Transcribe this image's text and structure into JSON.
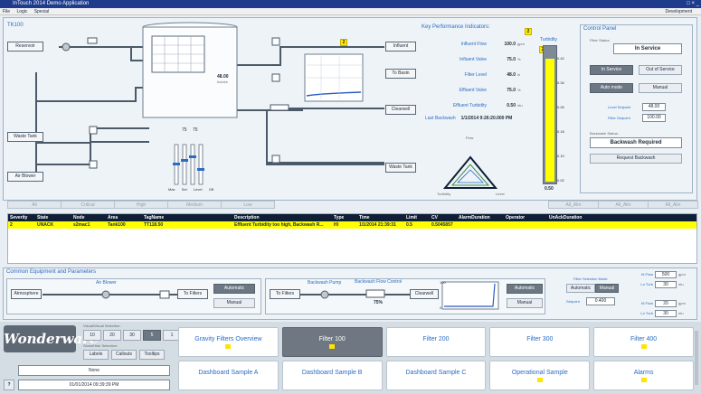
{
  "window": {
    "title": "InTouch 2014 Demo Application",
    "controls": "□ × _"
  },
  "menu": {
    "file": "File",
    "logic": "Logic",
    "special": "Special",
    "development": "Development"
  },
  "process": {
    "area_label": "TK100",
    "reservoir": "Reservoir",
    "waste_tank": "Waste Tank",
    "air_blower": "Air Blower",
    "influent": "Influent",
    "to_basin": "To Basin",
    "clearwell": "Clearwell",
    "waste_tank_2": "Waste Tank",
    "level_value": "48.00",
    "level_unit": "Inches",
    "valve_pct_1": "75",
    "valve_pct_2": "75",
    "level_labels": [
      "Max",
      "Set",
      "Level",
      "Off"
    ],
    "badge_1": "2"
  },
  "kpi": {
    "title": "Key Performance Indicators:",
    "rows": [
      {
        "label": "Influent Flow",
        "value": "100.0",
        "unit": "gpm"
      },
      {
        "label": "Influent Valve",
        "value": "75.0",
        "unit": "%"
      },
      {
        "label": "Filter Level",
        "value": "48.0",
        "unit": "in"
      },
      {
        "label": "Effluent Valve",
        "value": "75.0",
        "unit": "%"
      },
      {
        "label": "Effluent Turbidity",
        "value": "0.50",
        "unit": "ntu"
      }
    ],
    "last_backwash_label": "Last Backwash",
    "last_backwash_value": "1/1/2014 9:26:20.000 PM",
    "badge": "2"
  },
  "turbidity": {
    "title": "Turbidity",
    "badge": "2",
    "fill_fraction": 0.92,
    "ticks": [
      "0.42",
      "0.34",
      "0.26",
      "0.18",
      "0.10",
      "0.02"
    ],
    "bottom_value": "0.50",
    "gauge": {
      "flow": "Flow",
      "turbidity": "Turbidity",
      "level": "Level"
    }
  },
  "control_panel": {
    "title": "Control Panel",
    "filter_status_label": "Filter Status:",
    "filter_status": "In Service",
    "in_service_btn": "In Service",
    "out_of_service_btn": "Out of Service",
    "auto_mode_btn": "Auto mode",
    "manual_btn": "Manual",
    "level_setpoint_label": "Level Setpoint",
    "level_setpoint": "48.00",
    "flow_setpoint_label": "Filter Setpoint",
    "flow_setpoint": "100.00",
    "backwash_status_label": "Backwash Status:",
    "backwash_status": "Backwash Required",
    "request_backwash_btn": "Request Backwash"
  },
  "alarms": {
    "tabs": [
      "All",
      "Critical",
      "High",
      "Medium",
      "Low",
      "All_Alm",
      "All_Alm",
      "All_Alm"
    ],
    "columns": [
      "Severity",
      "State",
      "Node",
      "Area",
      "TagName",
      "Description",
      "Type",
      "Time",
      "Limit",
      "CV",
      "AlarmDuration",
      "Operator",
      "UnAckDuration"
    ],
    "rows": [
      [
        "2",
        "UNACK",
        "s2mac1",
        "Tank100",
        "TT118.50",
        "Effluent Turbidity too high, Backwash R...",
        "HI",
        "1/1/2014 21:39:31",
        "0.5",
        "0.5045857",
        "",
        "",
        ""
      ]
    ]
  },
  "common": {
    "title": "Common Equipment and Parameters",
    "atmosphere": "Atmosphere",
    "air_blower": "Air Blower",
    "to_filters": "To Filters",
    "automatic_btn": "Automatic",
    "manual_btn": "Manual",
    "to_filters_2": "To Filters",
    "backwash_pump": "Backwash Pump",
    "backwash_flow_control": "Backwash Flow Control",
    "backwash_pct": "75%",
    "clearwell": "Clearwell",
    "automatic_btn_2": "Automatic",
    "manual_btn_2": "Manual",
    "trend_max": "100",
    "trend_min": "0",
    "mode_title": "Filter Selection Mode",
    "mode_automatic": "Automatic",
    "mode_manual": "Manual",
    "setpoint_label": "Setpoint",
    "setpoint_value": "0.400",
    "params": [
      {
        "label": "Hi Flow",
        "value": "500",
        "unit": "gpm"
      },
      {
        "label": "Lo Turb",
        "value": "30",
        "unit": "ntu"
      },
      {
        "label": "Hi Flow",
        "value": "20",
        "unit": "gpm"
      },
      {
        "label": "Lo Turb",
        "value": "30",
        "unit": "ntu"
      }
    ]
  },
  "footer": {
    "logo": "Wonderware",
    "visual_label": "Visual/Visual Selection:",
    "selector_buttons": [
      "10",
      "20",
      "30",
      "5",
      "1"
    ],
    "shown_label": "Show/Hide Selection:",
    "toggle_buttons": [
      "Labels",
      "Callouts",
      "Tooltips"
    ],
    "none": "None",
    "datetime": "01/01/2014 09:39:39 PM",
    "help": "?",
    "nav": [
      {
        "label": "Gravity Filters Overview",
        "mark": true,
        "active": false
      },
      {
        "label": "Filter 100",
        "mark": true,
        "active": true
      },
      {
        "label": "Filter 200",
        "mark": false,
        "active": false
      },
      {
        "label": "Filter 300",
        "mark": false,
        "active": false
      },
      {
        "label": "Filter 400",
        "mark": true,
        "active": false
      },
      {
        "label": "Dashboard Sample A",
        "mark": false,
        "active": false
      },
      {
        "label": "Dashboard Sample B",
        "mark": false,
        "active": false
      },
      {
        "label": "Dashboard Sample C",
        "mark": false,
        "active": false
      },
      {
        "label": "Operational Sample",
        "mark": true,
        "active": false
      },
      {
        "label": "Alarms",
        "mark": true,
        "active": false
      }
    ]
  }
}
